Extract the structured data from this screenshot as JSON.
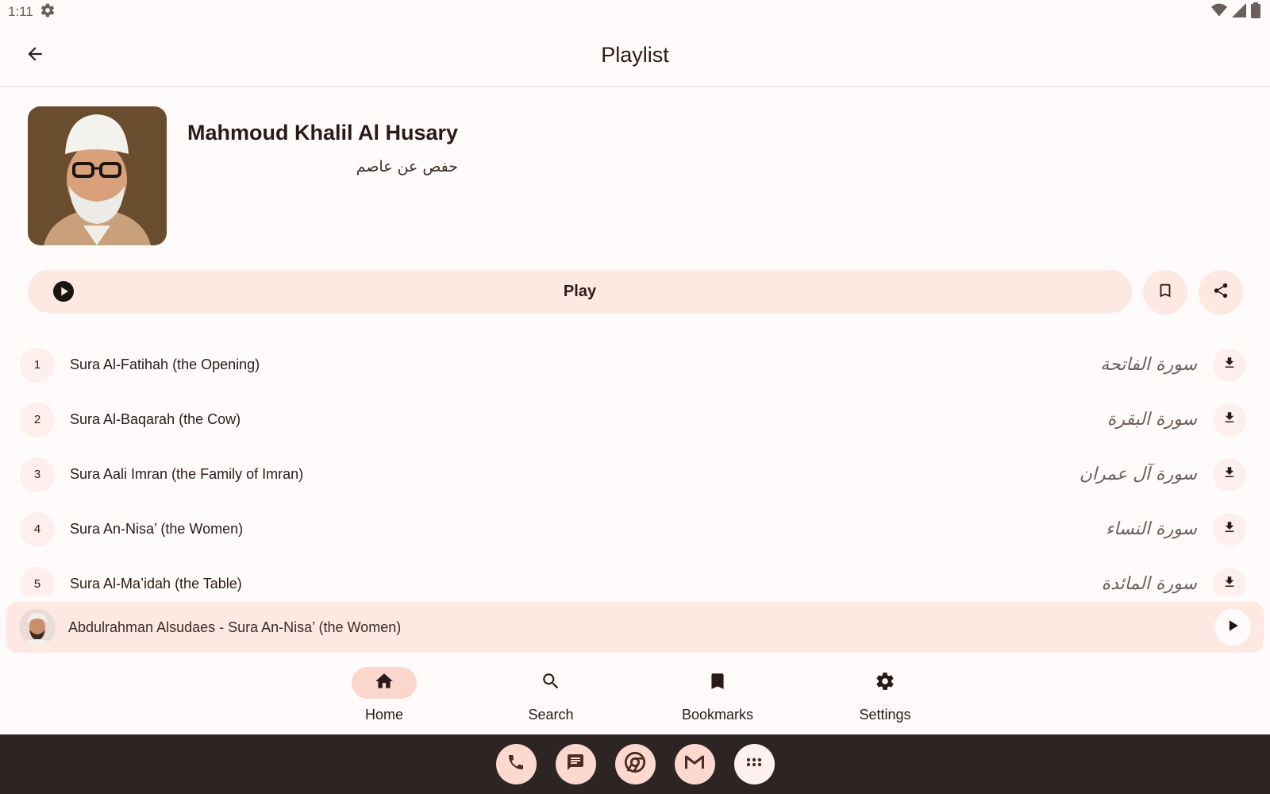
{
  "status_bar": {
    "time": "1:11"
  },
  "app_bar": {
    "title": "Playlist"
  },
  "reciter": {
    "name": "Mahmoud Khalil Al Husary",
    "riwayah": "حفص عن عاصم"
  },
  "actions": {
    "play_label": "Play"
  },
  "suras": [
    {
      "number": "1",
      "name": "Sura Al-Fatihah (the Opening)",
      "arabic": "سورة الفاتحة"
    },
    {
      "number": "2",
      "name": "Sura Al-Baqarah (the Cow)",
      "arabic": "سورة البقرة"
    },
    {
      "number": "3",
      "name": "Sura Aali Imran (the Family of Imran)",
      "arabic": "سورة آل عمران"
    },
    {
      "number": "4",
      "name": "Sura An-Nisa’ (the Women)",
      "arabic": "سورة النساء"
    },
    {
      "number": "5",
      "name": "Sura Al-Ma’idah (the Table)",
      "arabic": "سورة المائدة"
    }
  ],
  "mini_player": {
    "now_playing": "Abdulrahman Alsudaes - Sura An-Nisa’ (the Women)"
  },
  "bottom_nav": {
    "home": "Home",
    "search": "Search",
    "bookmarks": "Bookmarks",
    "settings": "Settings",
    "active": "home"
  },
  "colors": {
    "accent": "#fde8e2",
    "active_pill": "#fbd6cc",
    "dock": "#2d2523",
    "text": "#2a1a17"
  }
}
